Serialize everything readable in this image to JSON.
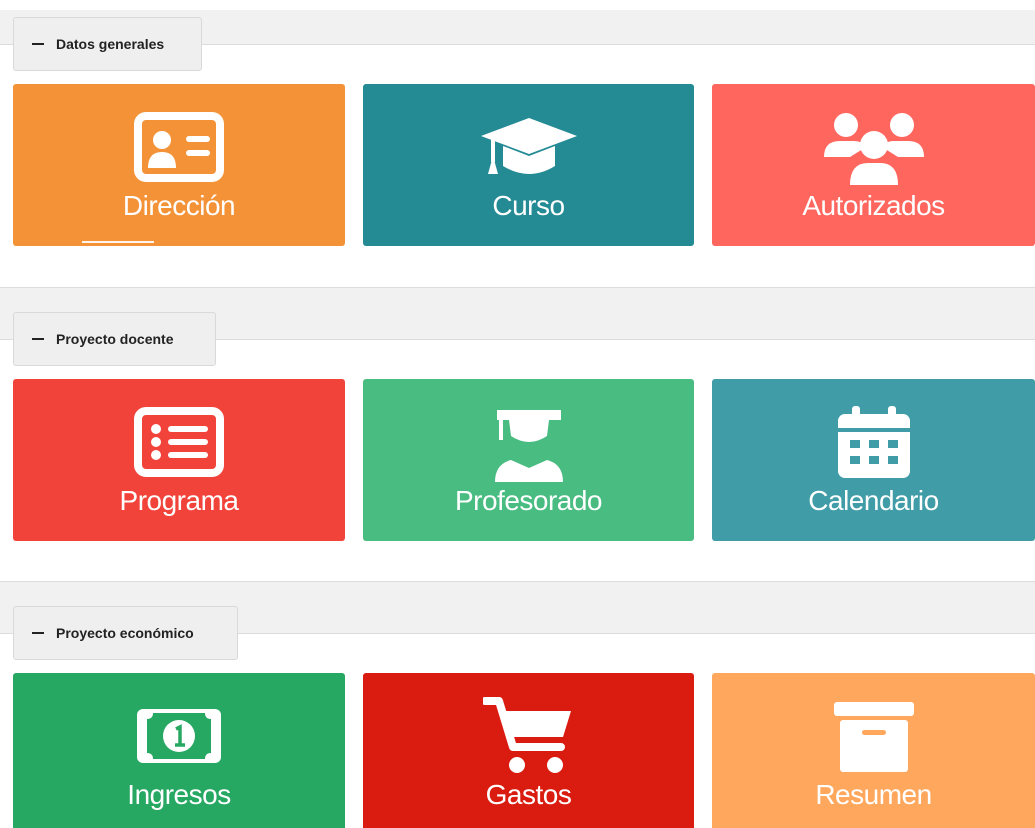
{
  "sections": [
    {
      "legend": "Datos generales",
      "tiles": [
        {
          "label": "Dirección",
          "icon": "id-card-icon",
          "color": "#f39237"
        },
        {
          "label": "Curso",
          "icon": "graduation-cap-icon",
          "color": "#248b95"
        },
        {
          "label": "Autorizados",
          "icon": "users-icon",
          "color": "#ff675e"
        }
      ]
    },
    {
      "legend": "Proyecto docente",
      "tiles": [
        {
          "label": "Programa",
          "icon": "list-alt-icon",
          "color": "#f2433a"
        },
        {
          "label": "Profesorado",
          "icon": "user-graduate-icon",
          "color": "#48bc81"
        },
        {
          "label": "Calendario",
          "icon": "calendar-icon",
          "color": "#409ca7"
        }
      ]
    },
    {
      "legend": "Proyecto económico",
      "tiles": [
        {
          "label": "Ingresos",
          "icon": "money-bill-icon",
          "color": "#27a862"
        },
        {
          "label": "Gastos",
          "icon": "shopping-cart-icon",
          "color": "#d91c0f"
        },
        {
          "label": "Resumen",
          "icon": "archive-box-icon",
          "color": "#ffa75d"
        }
      ]
    }
  ]
}
